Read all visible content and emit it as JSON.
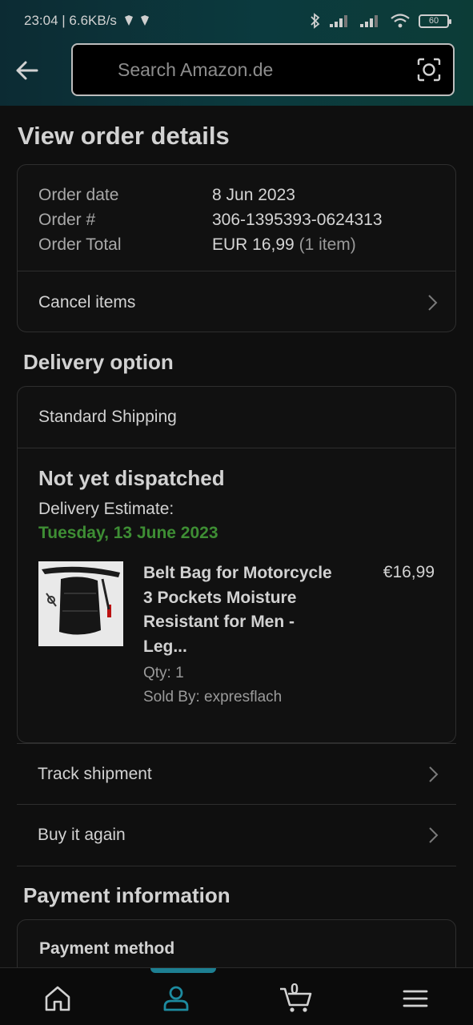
{
  "status_bar": {
    "time_speed": "23:04 | 6.6KB/s",
    "battery": "60"
  },
  "search": {
    "placeholder": "Search Amazon.de"
  },
  "page_title": "View order details",
  "order_summary": {
    "rows": [
      {
        "label": "Order date",
        "value": "8 Jun 2023"
      },
      {
        "label": "Order #",
        "value": "306-1395393-0624313"
      },
      {
        "label": "Order Total",
        "value": "EUR 16,99",
        "extra": "(1 item)"
      }
    ],
    "cancel_label": "Cancel items"
  },
  "delivery": {
    "heading": "Delivery option",
    "shipping_method": "Standard Shipping",
    "status": "Not yet dispatched",
    "estimate_label": "Delivery Estimate:",
    "estimate_date": "Tuesday, 13 June 2023",
    "item": {
      "name": "Belt Bag for Motorcycle 3 Pockets Moisture Resistant for Men - Leg...",
      "qty": "Qty: 1",
      "seller": "Sold By: expresflach",
      "price": "€16,99"
    }
  },
  "actions": {
    "track": "Track shipment",
    "buy_again": "Buy it again"
  },
  "payment": {
    "heading": "Payment information",
    "method_label": "Payment method"
  },
  "bottom_nav": {
    "cart_count": "0",
    "active": "account"
  },
  "colors": {
    "accent": "#1d7f92",
    "delivery_date": "#3e8e34"
  }
}
